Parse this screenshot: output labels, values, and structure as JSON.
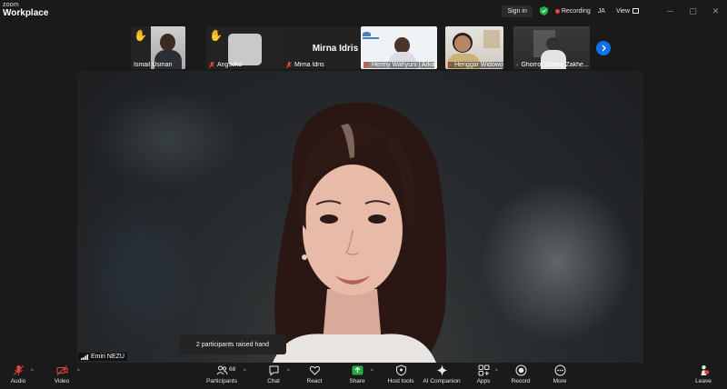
{
  "app": {
    "logo_top": "zoom",
    "logo_bottom": "Workplace"
  },
  "titlebar": {
    "sign_in": "Sign in",
    "recording": "Recording",
    "user_initials": "JA",
    "view": "View",
    "accent_color": "#0e72ed",
    "recording_color": "#e8443a"
  },
  "strip": {
    "participants": [
      {
        "name": "Ismail Usman",
        "raised_hand": true,
        "muted": false
      },
      {
        "name": "Angsoka",
        "raised_hand": true,
        "muted": true
      },
      {
        "name": "Mirna Idris",
        "raised_hand": false,
        "muted": true,
        "display_name": "Mirna Idris"
      },
      {
        "name": "Hermy Wahyuni | Arka",
        "raised_hand": false,
        "muted": true
      },
      {
        "name": "Henggar Widowo",
        "raised_hand": false,
        "muted": true
      },
      {
        "name": "Ghorrot Zidane Zakhe...",
        "raised_hand": false,
        "muted": true
      }
    ]
  },
  "main": {
    "speaker": "Emiri NEZU",
    "toast": "2 participants raised hand"
  },
  "toolbar": {
    "audio": "Audio",
    "video": "Video",
    "participants": "Participants",
    "participants_count": "68",
    "chat": "Chat",
    "react": "React",
    "share": "Share",
    "host_tools": "Host tools",
    "ai_companion": "AI Companion",
    "apps": "Apps",
    "record": "Record",
    "more": "More",
    "leave": "Leave",
    "share_color": "#1fb141",
    "muted_color": "#e8443a"
  }
}
